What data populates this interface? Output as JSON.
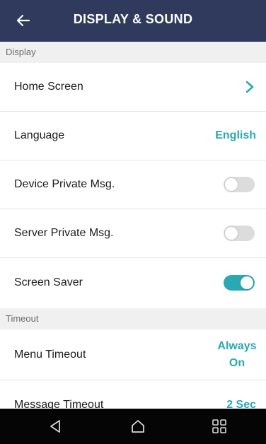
{
  "header": {
    "title": "DISPLAY & SOUND"
  },
  "sections": {
    "display_label": "Display",
    "timeout_label": "Timeout"
  },
  "rows": {
    "home_screen": {
      "label": "Home Screen"
    },
    "language": {
      "label": "Language",
      "value": "English"
    },
    "device_private_msg": {
      "label": "Device Private Msg.",
      "enabled": false
    },
    "server_private_msg": {
      "label": "Server Private Msg.",
      "enabled": false
    },
    "screen_saver": {
      "label": "Screen Saver",
      "enabled": true
    },
    "menu_timeout": {
      "label": "Menu Timeout",
      "value_line1": "Always",
      "value_line2": "On"
    },
    "message_timeout": {
      "label": "Message Timeout",
      "value": "2 Sec"
    }
  },
  "colors": {
    "header_bg": "#2f3a5c",
    "accent": "#2aa8b4",
    "toggle_off": "#dcdcdc",
    "section_bg": "#f0f0f0",
    "navbar_bg": "#050505"
  },
  "icons": {
    "back": "arrow-left-icon",
    "chevron": "chevron-right-icon",
    "nav_back": "triangle-back-icon",
    "nav_home": "home-icon",
    "nav_recent": "grid-icon"
  }
}
